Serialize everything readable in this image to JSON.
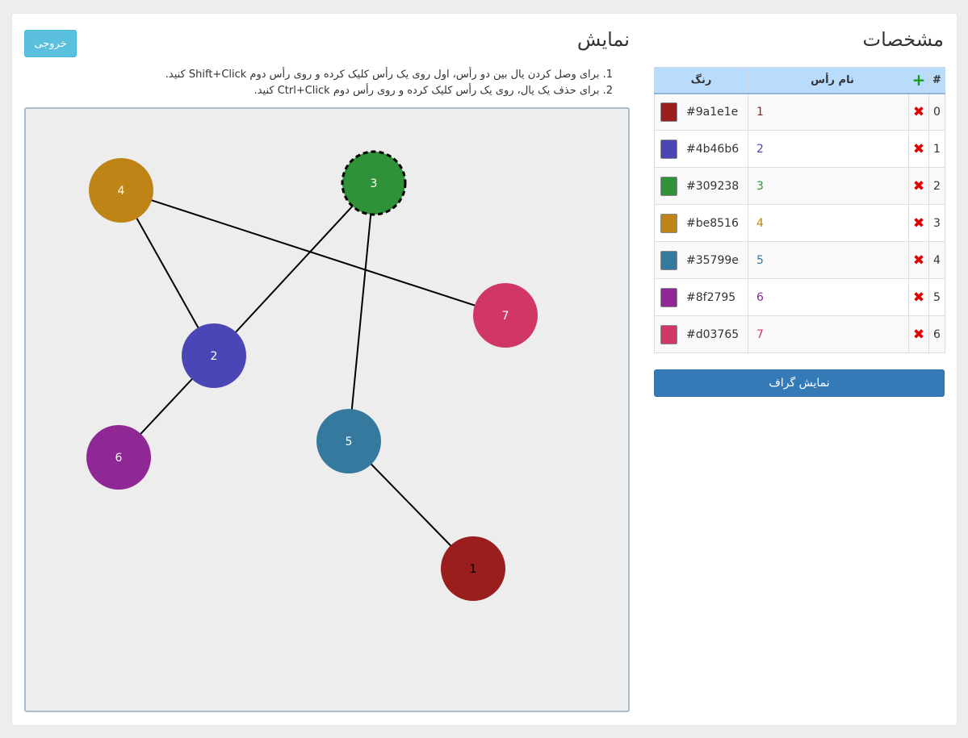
{
  "properties": {
    "title": "مشخصات",
    "table": {
      "headers": {
        "index": "#",
        "add": "+",
        "name": "نام رأس",
        "color": "رنگ"
      },
      "rows": [
        {
          "index": "0",
          "name": "1",
          "color": "#9a1e1e"
        },
        {
          "index": "1",
          "name": "2",
          "color": "#4b46b6"
        },
        {
          "index": "2",
          "name": "3",
          "color": "#309238"
        },
        {
          "index": "3",
          "name": "4",
          "color": "#be8516"
        },
        {
          "index": "4",
          "name": "5",
          "color": "#35799e"
        },
        {
          "index": "5",
          "name": "6",
          "color": "#8f2795"
        },
        {
          "index": "6",
          "name": "7",
          "color": "#d03765"
        }
      ]
    },
    "show_graph_label": "نمایش گراف"
  },
  "display": {
    "title": "نمایش",
    "export_label": "خروجی",
    "instructions": [
      "1. برای وصل کردن یال بین دو رأس، اول روی یک رأس کلیک کرده و روی رأس دوم Shift+Click کنید.",
      "2. برای حذف یک یال، روی یک رأس کلیک کرده و روی رأس دوم Ctrl+Click کنید."
    ]
  },
  "graph": {
    "selected_node": "3",
    "edges": [
      [
        "4",
        "7"
      ],
      [
        "4",
        "2"
      ],
      [
        "3",
        "2"
      ],
      [
        "3",
        "5"
      ],
      [
        "2",
        "6"
      ],
      [
        "5",
        "1"
      ]
    ]
  }
}
